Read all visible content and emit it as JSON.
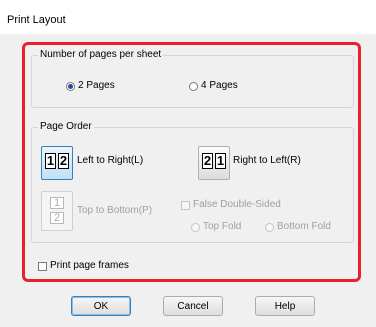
{
  "window": {
    "title": "Print Layout"
  },
  "pages_per_sheet": {
    "legend": "Number of pages per sheet",
    "options": [
      {
        "label": "2 Pages",
        "checked": true
      },
      {
        "label": "4 Pages",
        "checked": false
      }
    ]
  },
  "page_order": {
    "legend": "Page Order",
    "left_to_right": {
      "label": "Left to Right(L)",
      "icon": [
        "1",
        "2"
      ],
      "selected": true
    },
    "right_to_left": {
      "label": "Right to Left(R)",
      "icon": [
        "2",
        "1"
      ],
      "selected": false
    },
    "top_to_bottom": {
      "label": "Top to Bottom(P)",
      "icon": [
        "1",
        "2"
      ],
      "enabled": false
    },
    "false_double_sided": {
      "label": "False Double-Sided",
      "enabled": false
    },
    "top_fold": {
      "label": "Top Fold",
      "enabled": false
    },
    "bottom_fold": {
      "label": "Bottom Fold",
      "enabled": false
    }
  },
  "print_page_frames": {
    "label": "Print page frames",
    "checked": false
  },
  "buttons": {
    "ok": "OK",
    "cancel": "Cancel",
    "help": "Help"
  },
  "colors": {
    "highlight": "#e8202c",
    "accent": "#3c7fb1"
  }
}
